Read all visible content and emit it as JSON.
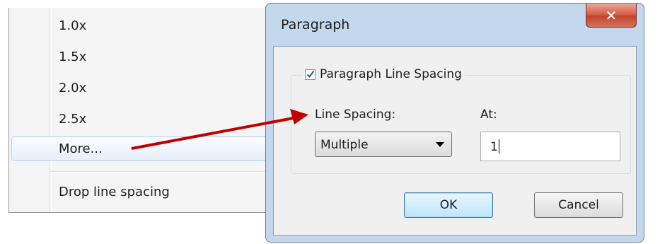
{
  "menu": {
    "items": [
      {
        "label": "1.0x"
      },
      {
        "label": "1.5x"
      },
      {
        "label": "2.0x"
      },
      {
        "label": "2.5x"
      },
      {
        "label": "More..."
      },
      {
        "label": "Drop line spacing"
      }
    ],
    "highlighted": "More..."
  },
  "dialog": {
    "title": "Paragraph",
    "close_icon": "close-x-icon",
    "group_label": "Paragraph Line Spacing",
    "group_checked": true,
    "line_spacing_label": "Line Spacing:",
    "line_spacing_value": "Multiple",
    "at_label": "At:",
    "at_value": "1",
    "ok_label": "OK",
    "cancel_label": "Cancel"
  },
  "colors": {
    "arrow": "#c00000",
    "dialog_frame": "#c3d7ed",
    "close_button": "#c3432b"
  }
}
